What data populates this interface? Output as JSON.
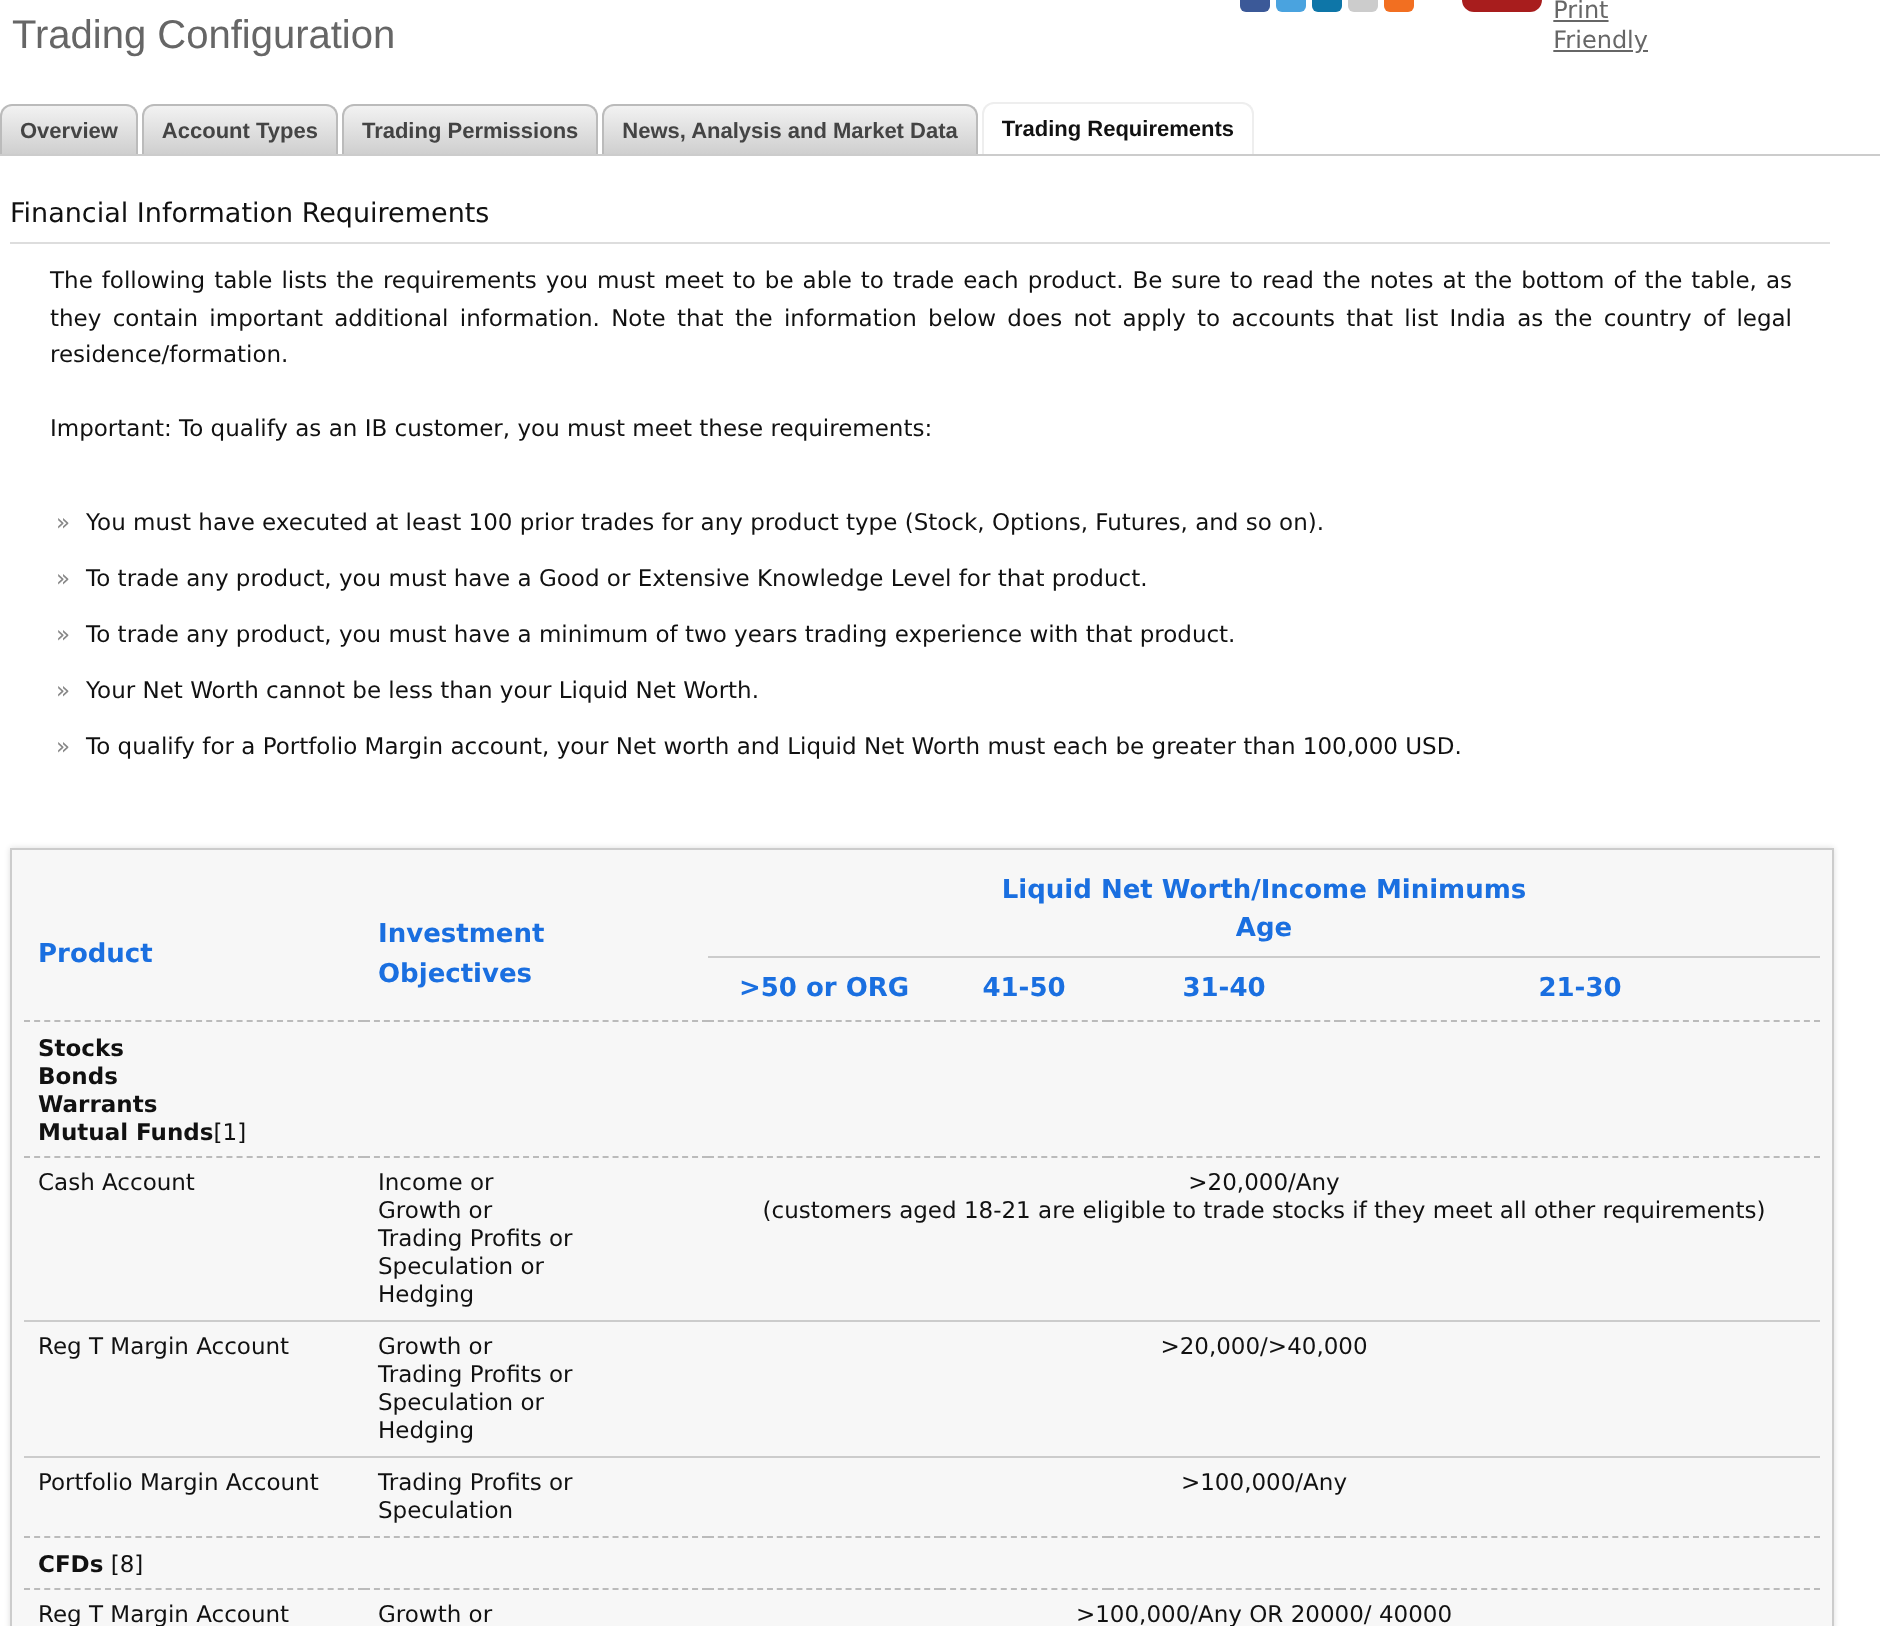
{
  "page_title": "Trading Configuration",
  "print_link": {
    "line_1": "Print",
    "line_2": "Friendly"
  },
  "tabs": [
    {
      "label": "Overview",
      "selected": false
    },
    {
      "label": "Account Types",
      "selected": false
    },
    {
      "label": "Trading Permissions",
      "selected": false
    },
    {
      "label": "News, Analysis and Market Data",
      "selected": false
    },
    {
      "label": "Trading Requirements",
      "selected": true
    }
  ],
  "section_title": "Financial Information Requirements",
  "intro": "The following table lists the requirements you must meet to be able to trade each product. Be sure to read the notes at the bottom of the table, as they contain important additional information. Note that the information below does not apply to accounts that list India as the country of legal residence/formation.",
  "important": "Important: To qualify as an IB customer, you must meet these requirements:",
  "requirements": [
    {
      "bullet": "»",
      "text": "You must have executed at least 100 prior trades for any product type (Stock, Options, Futures, and so on)."
    },
    {
      "bullet": "»",
      "text": "To trade any product, you must have a Good or Extensive Knowledge Level for that product."
    },
    {
      "bullet": "»",
      "text": "To trade any product, you must have a minimum of two years trading experience with that product."
    },
    {
      "bullet": "»",
      "text": "Your Net Worth cannot be less than your Liquid Net Worth."
    },
    {
      "bullet": "»",
      "text": "To qualify for a Portfolio Margin account, your Net worth and Liquid Net Worth must each be greater than 100,000 USD."
    }
  ],
  "table": {
    "columns": {
      "product": "Product",
      "objectives": "Investment Objectives",
      "minimums": "Liquid Net Worth/Income Minimums",
      "age": "Age",
      "ages": [
        ">50 or ORG",
        "41-50",
        "31-40",
        "21-30"
      ]
    },
    "rows": [
      {
        "kind": "group",
        "lines": [
          "**Stocks**",
          "**Bonds**",
          "**Warrants**",
          "**Mutual Funds**[1]"
        ]
      },
      {
        "kind": "account",
        "product": "Cash Account",
        "objectives": [
          "Income or",
          "Growth or",
          "Trading Profits or",
          "Speculation or",
          "Hedging"
        ],
        "values": [
          ">20,000/Any",
          "(customers aged 18-21 are eligible to trade stocks if they meet all other requirements)"
        ]
      },
      {
        "kind": "account",
        "product": "Reg T Margin Account",
        "objectives": [
          "Growth or",
          "Trading Profits or",
          "Speculation or",
          "Hedging"
        ],
        "values": [
          ">20,000/>40,000"
        ]
      },
      {
        "kind": "account",
        "product": "Portfolio Margin Account",
        "objectives": [
          "Trading Profits or",
          "Speculation"
        ],
        "values": [
          ">100,000/Any"
        ]
      },
      {
        "kind": "group",
        "lines": [
          "**CFDs** [8]"
        ]
      },
      {
        "kind": "account",
        "product": "Reg T Margin Account",
        "objectives": [
          "Growth or"
        ],
        "values": [
          ">100,000/Any OR 20000/ 40000"
        ]
      }
    ]
  }
}
